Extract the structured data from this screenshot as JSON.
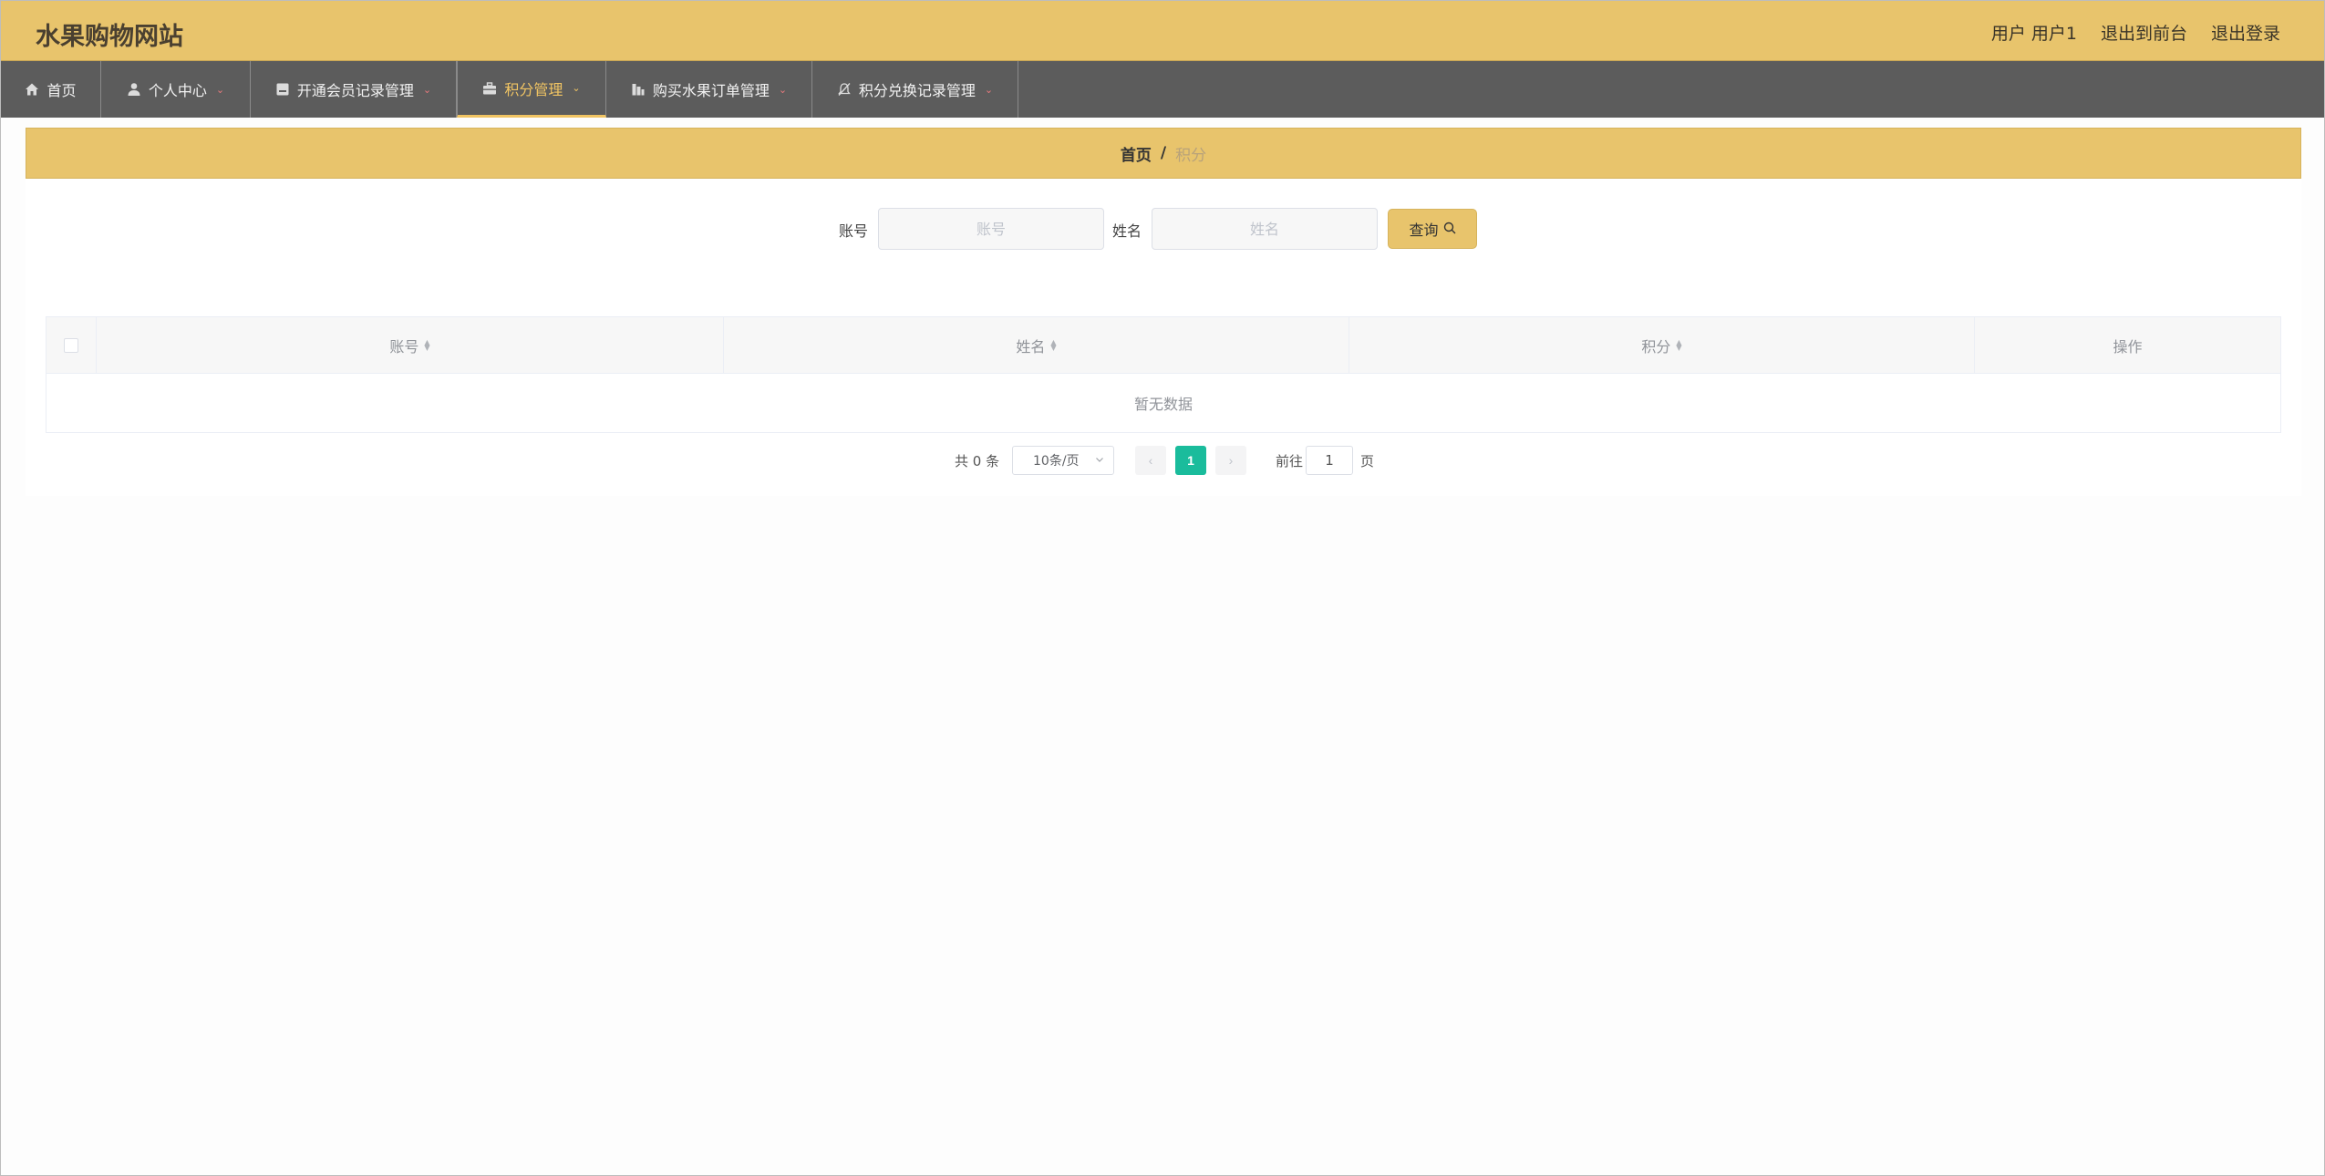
{
  "header": {
    "site_title": "水果购物网站",
    "user_label": "用户 用户1",
    "to_front_label": "退出到前台",
    "logout_label": "退出登录"
  },
  "nav": {
    "items": [
      {
        "label": "首页",
        "icon": "home-icon"
      },
      {
        "label": "个人中心",
        "icon": "user-icon"
      },
      {
        "label": "开通会员记录管理",
        "icon": "card-icon"
      },
      {
        "label": "积分管理",
        "icon": "briefcase-icon"
      },
      {
        "label": "购买水果订单管理",
        "icon": "chart-icon"
      },
      {
        "label": "积分兑换记录管理",
        "icon": "bell-off-icon"
      }
    ],
    "active_index": 3
  },
  "breadcrumb": {
    "home": "首页",
    "separator": "/",
    "current": "积分"
  },
  "search": {
    "account_label": "账号",
    "account_placeholder": "账号",
    "account_value": "",
    "name_label": "姓名",
    "name_placeholder": "姓名",
    "name_value": "",
    "query_label": "查询"
  },
  "table": {
    "columns": [
      "账号",
      "姓名",
      "积分",
      "操作"
    ],
    "rows": [],
    "empty_text": "暂无数据"
  },
  "pagination": {
    "total_text": "共 0 条",
    "page_size": "10条/页",
    "current_page": "1",
    "goto_label": "前往",
    "goto_value": "1",
    "page_suffix": "页"
  },
  "colors": {
    "accent": "#e8c46c",
    "nav_bg": "#5c5c5c",
    "active_nav": "#f0c463",
    "page_active": "#1abc9c"
  }
}
